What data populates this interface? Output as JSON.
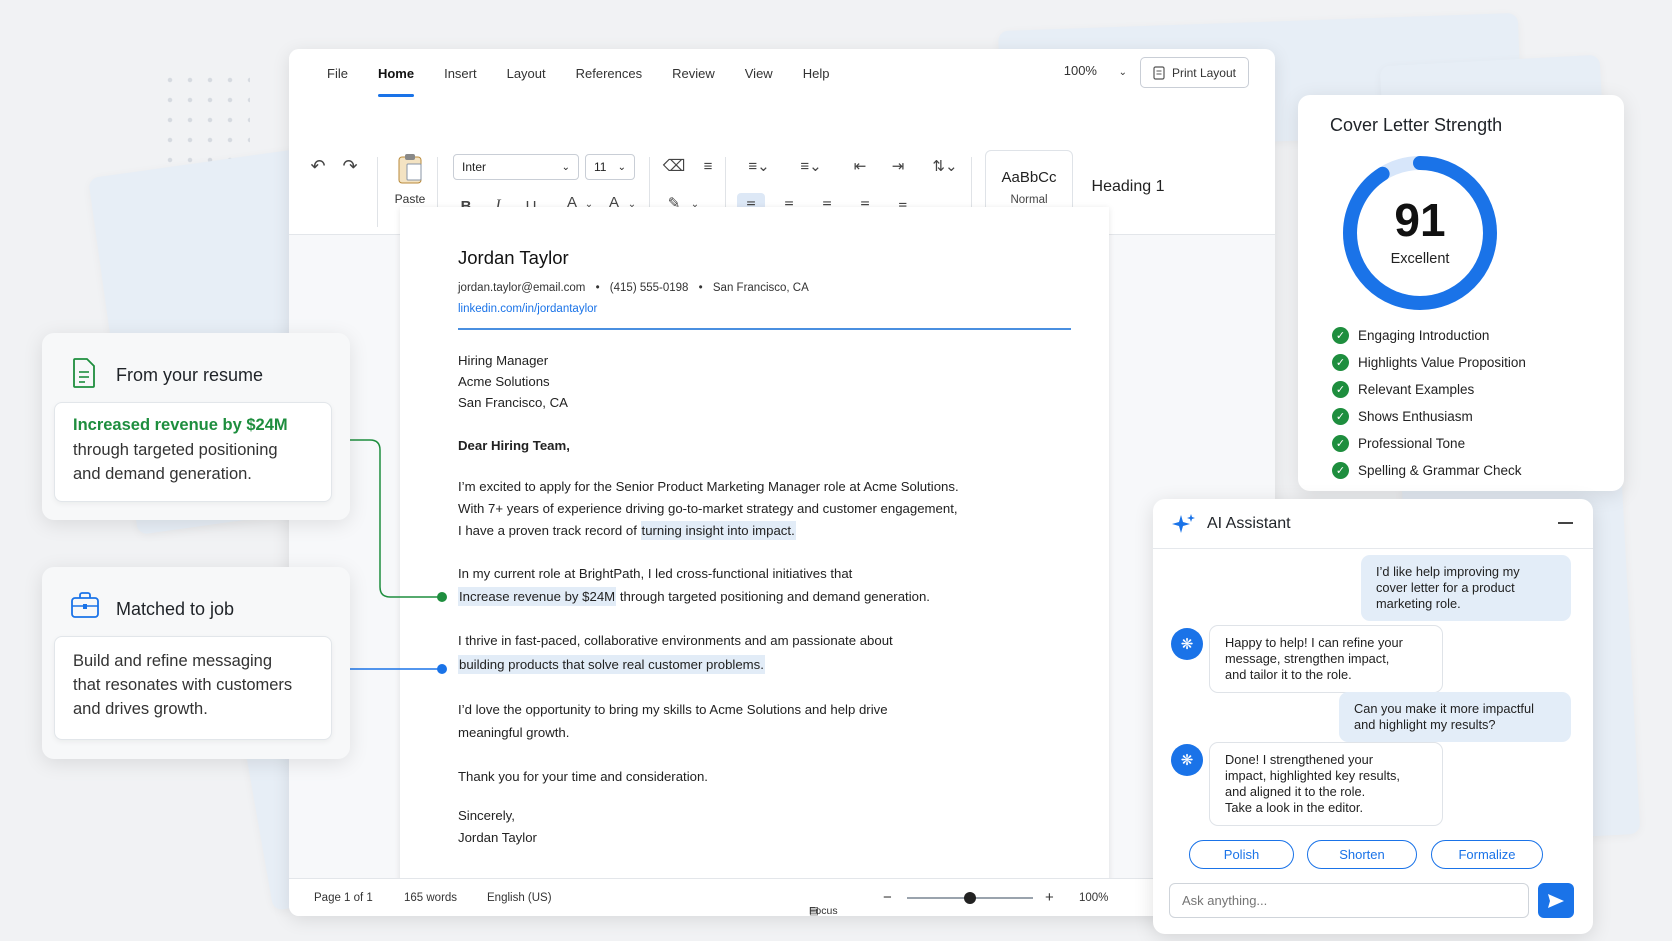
{
  "menu": {
    "items": [
      "File",
      "Home",
      "Insert",
      "Layout",
      "References",
      "Review",
      "View",
      "Help"
    ],
    "zoom": "100%",
    "print_layout": "Print Layout"
  },
  "ribbon": {
    "paste": "Paste",
    "font": "Inter",
    "size": "11",
    "bold": "B",
    "italic": "I",
    "underline": "U",
    "font_color": "A",
    "highlight_letter": "A",
    "style_normal_preview": "AaBbCc",
    "style_normal": "Normal",
    "style_heading": "Heading 1"
  },
  "document": {
    "name": "Jordan Taylor",
    "email": "jordan.taylor@email.com",
    "phone": "(415) 555-0198",
    "location": "San Francisco, CA",
    "linkedin": "linkedin.com/in/jordantaylor",
    "recipient": [
      "Hiring Manager",
      "Acme Solutions",
      "San Francisco, CA"
    ],
    "salutation": "Dear Hiring Team,",
    "p1_l1": "I’m excited to apply for the Senior Product Marketing Manager role at Acme Solutions.",
    "p1_l2": "With 7+ years of experience driving go-to-market strategy and customer engagement,",
    "p1_l3a": "I have a proven track record of ",
    "p1_l3b": "turning insight into impact.",
    "p2_l1": "In my current role at BrightPath, I led cross-functional initiatives that",
    "p2_l2a": "Increase revenue by $24M",
    "p2_l2b": " through targeted positioning and demand generation.",
    "p3_l1": "I thrive in fast-paced, collaborative environments and am passionate about",
    "p3_l2": "building products that solve real customer problems.",
    "p4_l1": "I’d love the opportunity to bring my skills to Acme Solutions and help drive",
    "p4_l2": "meaningful growth.",
    "thanks": "Thank you for your time and consideration.",
    "closing": "Sincerely,",
    "signature": "Jordan Taylor"
  },
  "status": {
    "page": "Page 1 of 1",
    "words": "165 words",
    "language": "English (US)",
    "focus": "Focus",
    "zoom": "100%",
    "zoom_level": 0.5
  },
  "resume_card": {
    "title": "From your resume",
    "highlight": "Increased revenue by $24M",
    "l1": "through targeted positioning",
    "l2": "and demand generation."
  },
  "job_card": {
    "title": "Matched to job",
    "l1": "Build and refine messaging",
    "l2": "that resonates with customers",
    "l3": "and drives growth."
  },
  "strength": {
    "title": "Cover Letter Strength",
    "score": "91",
    "score_fraction": 0.91,
    "label": "Excellent",
    "checks": [
      "Engaging Introduction",
      "Highlights Value Proposition",
      "Relevant Examples",
      "Shows Enthusiasm",
      "Professional Tone",
      "Spelling & Grammar Check"
    ]
  },
  "assistant": {
    "title": "AI Assistant",
    "m1": [
      "I’d like help improving my",
      "cover letter for a product",
      "marketing role."
    ],
    "m2": [
      "Happy to help! I can refine your",
      "message, strengthen impact,",
      "and tailor it to the role."
    ],
    "m3": [
      "Can you make it more impactful",
      "and highlight my results?"
    ],
    "m4": [
      "Done! I strengthened your",
      "impact, highlighted key results,",
      "and aligned it to the role.",
      "Take a look in the editor."
    ],
    "chips": [
      "Polish",
      "Shorten",
      "Formalize"
    ],
    "placeholder": "Ask anything..."
  },
  "colors": {
    "accent": "#1a73e8",
    "success": "#1e8e3e",
    "highlight": "#e2ecf7"
  }
}
